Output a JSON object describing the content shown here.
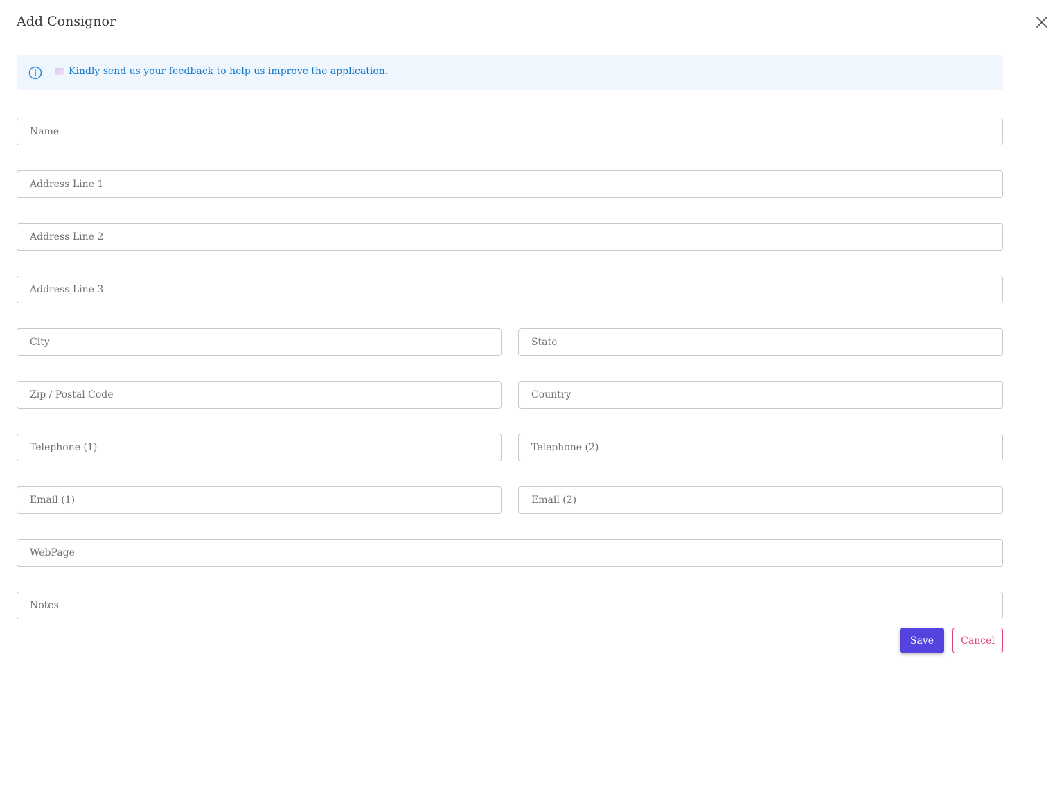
{
  "dialog": {
    "title": "Add Consignor",
    "close_icon": "close-icon"
  },
  "banner": {
    "icon": "info-icon",
    "message": "Kindly send us your feedback to help us improve the application.",
    "text_color": "#1276c9",
    "background": "#eff6fe"
  },
  "form": {
    "name": {
      "placeholder": "Name",
      "value": ""
    },
    "address_line_1": {
      "placeholder": "Address Line 1",
      "value": ""
    },
    "address_line_2": {
      "placeholder": "Address Line 2",
      "value": ""
    },
    "address_line_3": {
      "placeholder": "Address Line 3",
      "value": ""
    },
    "city": {
      "placeholder": "City",
      "value": ""
    },
    "state": {
      "placeholder": "State",
      "value": ""
    },
    "zip": {
      "placeholder": "Zip / Postal Code",
      "value": ""
    },
    "country": {
      "placeholder": "Country",
      "value": ""
    },
    "telephone_1": {
      "placeholder": "Telephone (1)",
      "value": ""
    },
    "telephone_2": {
      "placeholder": "Telephone (2)",
      "value": ""
    },
    "email_1": {
      "placeholder": "Email (1)",
      "value": ""
    },
    "email_2": {
      "placeholder": "Email (2)",
      "value": ""
    },
    "webpage": {
      "placeholder": "WebPage",
      "value": ""
    },
    "notes": {
      "placeholder": "Notes",
      "value": ""
    }
  },
  "actions": {
    "save_label": "Save",
    "cancel_label": "Cancel",
    "save_color": "#5543df",
    "cancel_color": "#e2407a"
  }
}
